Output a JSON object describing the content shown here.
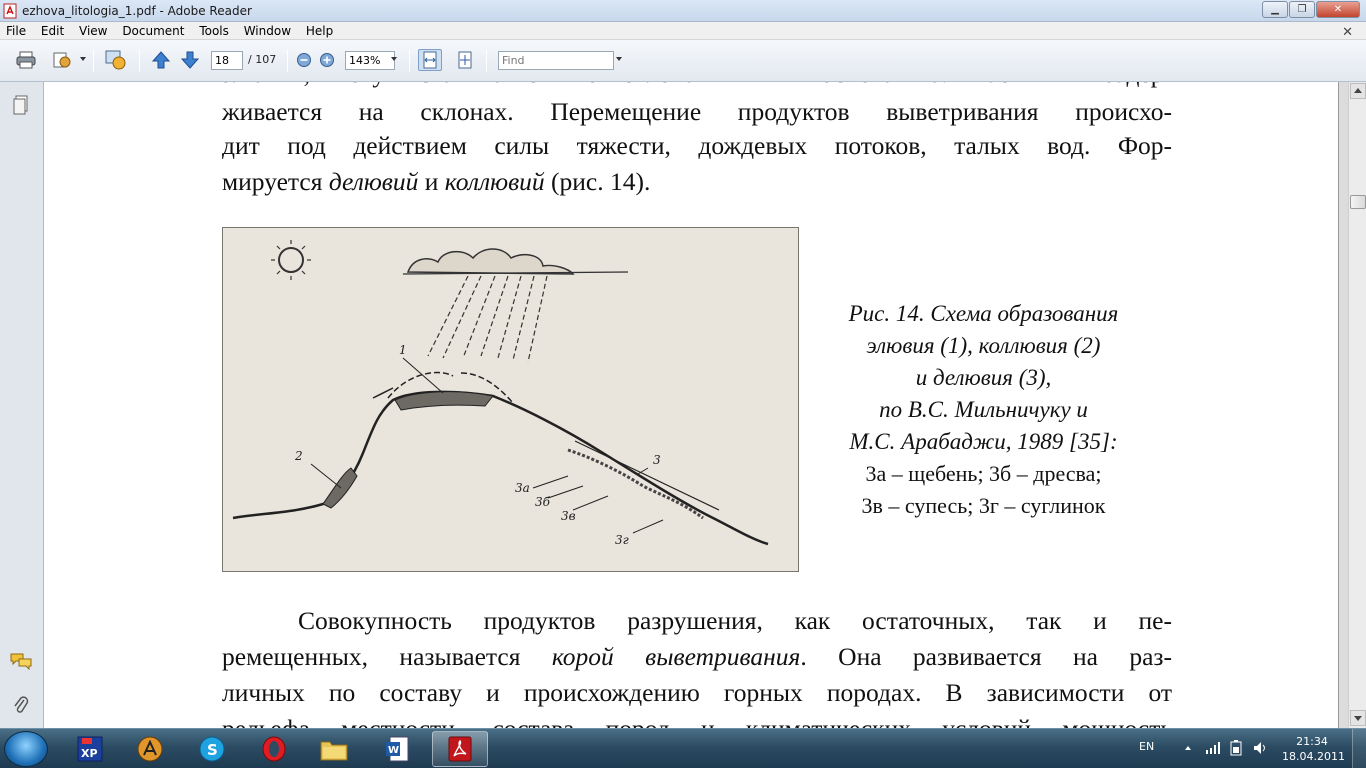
{
  "window": {
    "title": "ezhova_litologia_1.pdf - Adobe Reader",
    "min_label": "▁",
    "max_label": "❐",
    "close_label": "✕"
  },
  "menu": {
    "items": [
      "File",
      "Edit",
      "View",
      "Document",
      "Tools",
      "Window",
      "Help"
    ],
    "close_doc": "✕"
  },
  "toolbar": {
    "page_current": "18",
    "page_total": "/ 107",
    "zoom": "143%",
    "find_placeholder": "Find"
  },
  "document": {
    "top_cut": "элювии, могут скатываться по склонам к их основанию. Часть их задер-",
    "line1": "живается на склонах. Перемещение продуктов выветривания происхо-",
    "line2": "дит под действием силы тяжести, дождевых потоков, талых вод. Фор-",
    "line3_a": "мируется ",
    "line3_b": "делювий",
    "line3_c": " и ",
    "line3_d": "коллювий",
    "line3_e": " (рис. 14).",
    "figure_labels": {
      "l1": "1",
      "l2": "2",
      "l3": "3",
      "l3a": "3а",
      "l3b": "3б",
      "l3v": "3в",
      "l3g": "3г"
    },
    "caption": {
      "c1": "Рис. 14. Схема образования",
      "c2": "элювия (1), коллювия (2)",
      "c3": "и делювия (3),",
      "c4": "по В.С. Мильничуку и",
      "c5": "М.С. Арабаджи, 1989 [35]:",
      "c6": "3а – щебень; 3б – дресва;",
      "c7": "3в – супесь; 3г – суглинок"
    },
    "para2_line1": "Совокупность продуктов разрушения, как остаточных, так и пе-",
    "para2_line2_a": "ремещенных, называется ",
    "para2_line2_b": "корой выветривания",
    "para2_line2_c": ". Она развивается на раз-",
    "para2_line3": "личных по составу и происхождению горных породах. В зависимости от",
    "para2_line4_cut": "рельефа местности, состава пород и климатических условий мощность"
  },
  "taskbar": {
    "language": "EN",
    "time": "21:34",
    "date": "18.04.2011"
  }
}
